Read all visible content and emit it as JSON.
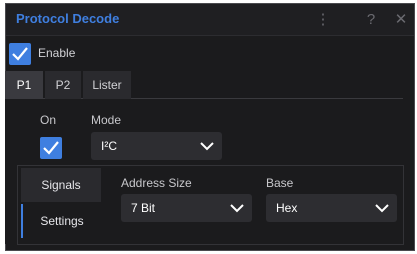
{
  "window": {
    "title": "Protocol Decode",
    "menu_icon": "kebab-icon",
    "help_icon": "help-icon",
    "close_icon": "close-icon"
  },
  "enable": {
    "label": "Enable",
    "checked": true
  },
  "tabs": [
    {
      "label": "P1",
      "active": true
    },
    {
      "label": "P2",
      "active": false
    },
    {
      "label": "Lister",
      "active": false
    }
  ],
  "on": {
    "label": "On",
    "checked": true
  },
  "mode": {
    "label": "Mode",
    "value": "I²C"
  },
  "side_tabs": [
    {
      "label": "Signals",
      "active": false
    },
    {
      "label": "Settings",
      "active": true
    }
  ],
  "address_size": {
    "label": "Address Size",
    "value": "7 Bit"
  },
  "base": {
    "label": "Base",
    "value": "Hex"
  },
  "colors": {
    "accent": "#3f7fe0",
    "background": "#1b1b1d"
  }
}
